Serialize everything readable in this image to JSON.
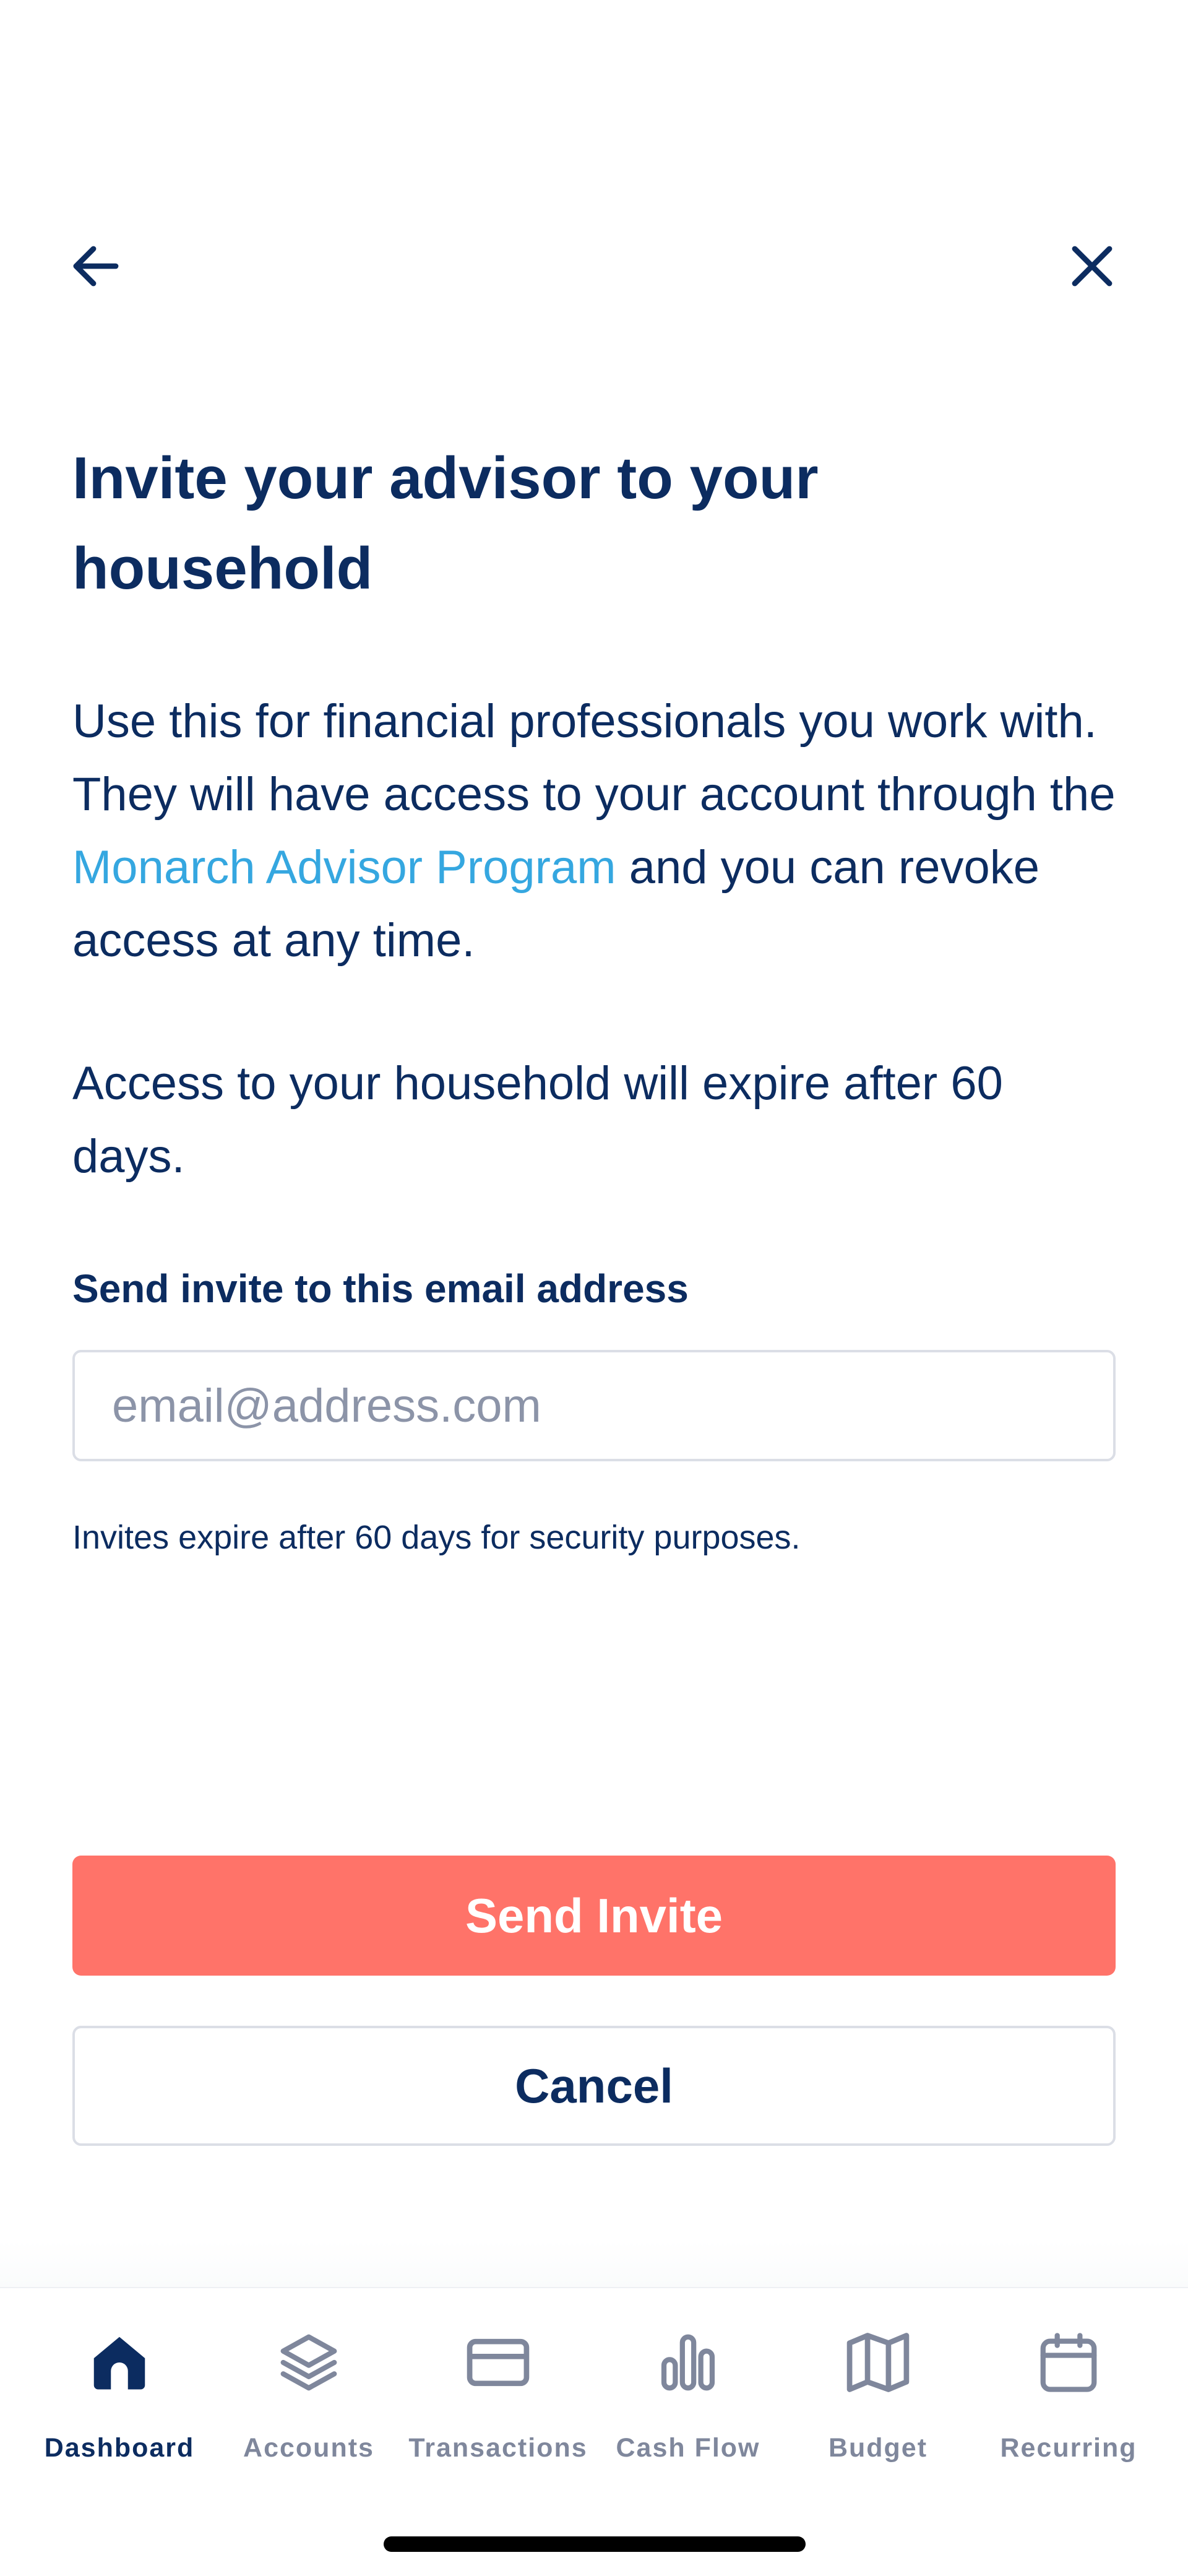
{
  "header": {
    "back_icon": "arrow-left-icon",
    "close_icon": "close-icon"
  },
  "title": "Invite your advisor to your household",
  "intro": {
    "text_before_link": "Use this for financial professionals you work with. They will have access to your account through the ",
    "link_text": "Monarch Advisor Program",
    "text_after_link": " and you can revoke access at any time."
  },
  "expiry_note": "Access to your household will expire after 60 days.",
  "email_field": {
    "label": "Send invite to this email address",
    "placeholder": "email@address.com",
    "value": ""
  },
  "hint": "Invites expire after 60 days for security purposes.",
  "buttons": {
    "send_invite": "Send Invite",
    "cancel": "Cancel"
  },
  "tabbar": {
    "items": [
      {
        "label": "Dashboard",
        "icon": "home-icon",
        "active": true
      },
      {
        "label": "Accounts",
        "icon": "layers-icon",
        "active": false
      },
      {
        "label": "Transactions",
        "icon": "credit-card-icon",
        "active": false
      },
      {
        "label": "Cash Flow",
        "icon": "bar-chart-icon",
        "active": false
      },
      {
        "label": "Budget",
        "icon": "map-icon",
        "active": false
      },
      {
        "label": "Recurring",
        "icon": "calendar-icon",
        "active": false
      }
    ]
  },
  "colors": {
    "text": "#0c2c60",
    "link": "#35a7e0",
    "primary_button": "#ff7369",
    "muted": "#7f879c",
    "border": "#dbdee6"
  }
}
